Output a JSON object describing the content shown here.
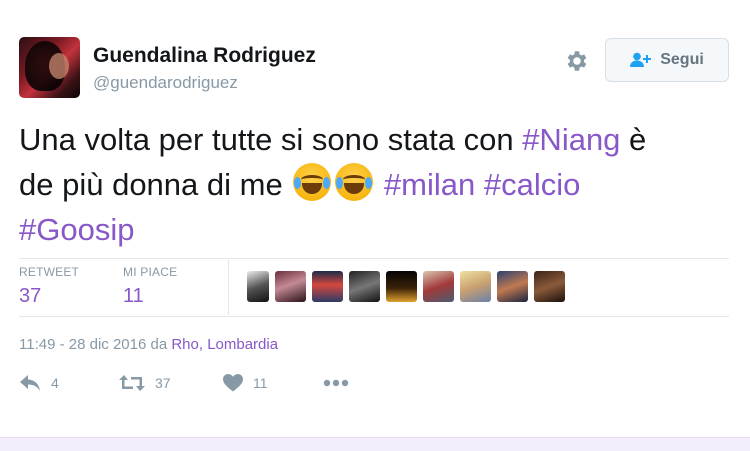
{
  "user": {
    "name": "Guendalina Rodriguez",
    "handle": "@guendarodriguez"
  },
  "follow_button": {
    "label": "Segui"
  },
  "tweet": {
    "line1_text": "Una volta per tutte si sono stata con ",
    "line1_hashtag": "#Niang",
    "line1_tail": " è",
    "line2_text": "de più donna di me ",
    "hashtag_milan": "#milan",
    "hashtag_calcio": "#calcio",
    "hashtag_goosip": "#Goosip"
  },
  "stats": {
    "retweet_label": "RETWEET",
    "retweet_value": "37",
    "likes_label": "MI PIACE",
    "likes_value": "11"
  },
  "meta": {
    "timestamp": "11:49 - 28 dic 2016 da ",
    "location": "Rho, Lombardia"
  },
  "actions": {
    "reply_count": "4",
    "retweet_count": "37",
    "like_count": "11"
  },
  "colors": {
    "accent": "#8858c8",
    "muted": "#8899a6",
    "text": "#14171a"
  },
  "icons": [
    "gear-icon",
    "follow-user-icon",
    "reply-icon",
    "retweet-icon",
    "heart-icon",
    "more-icon",
    "tears-of-joy-emoji"
  ]
}
